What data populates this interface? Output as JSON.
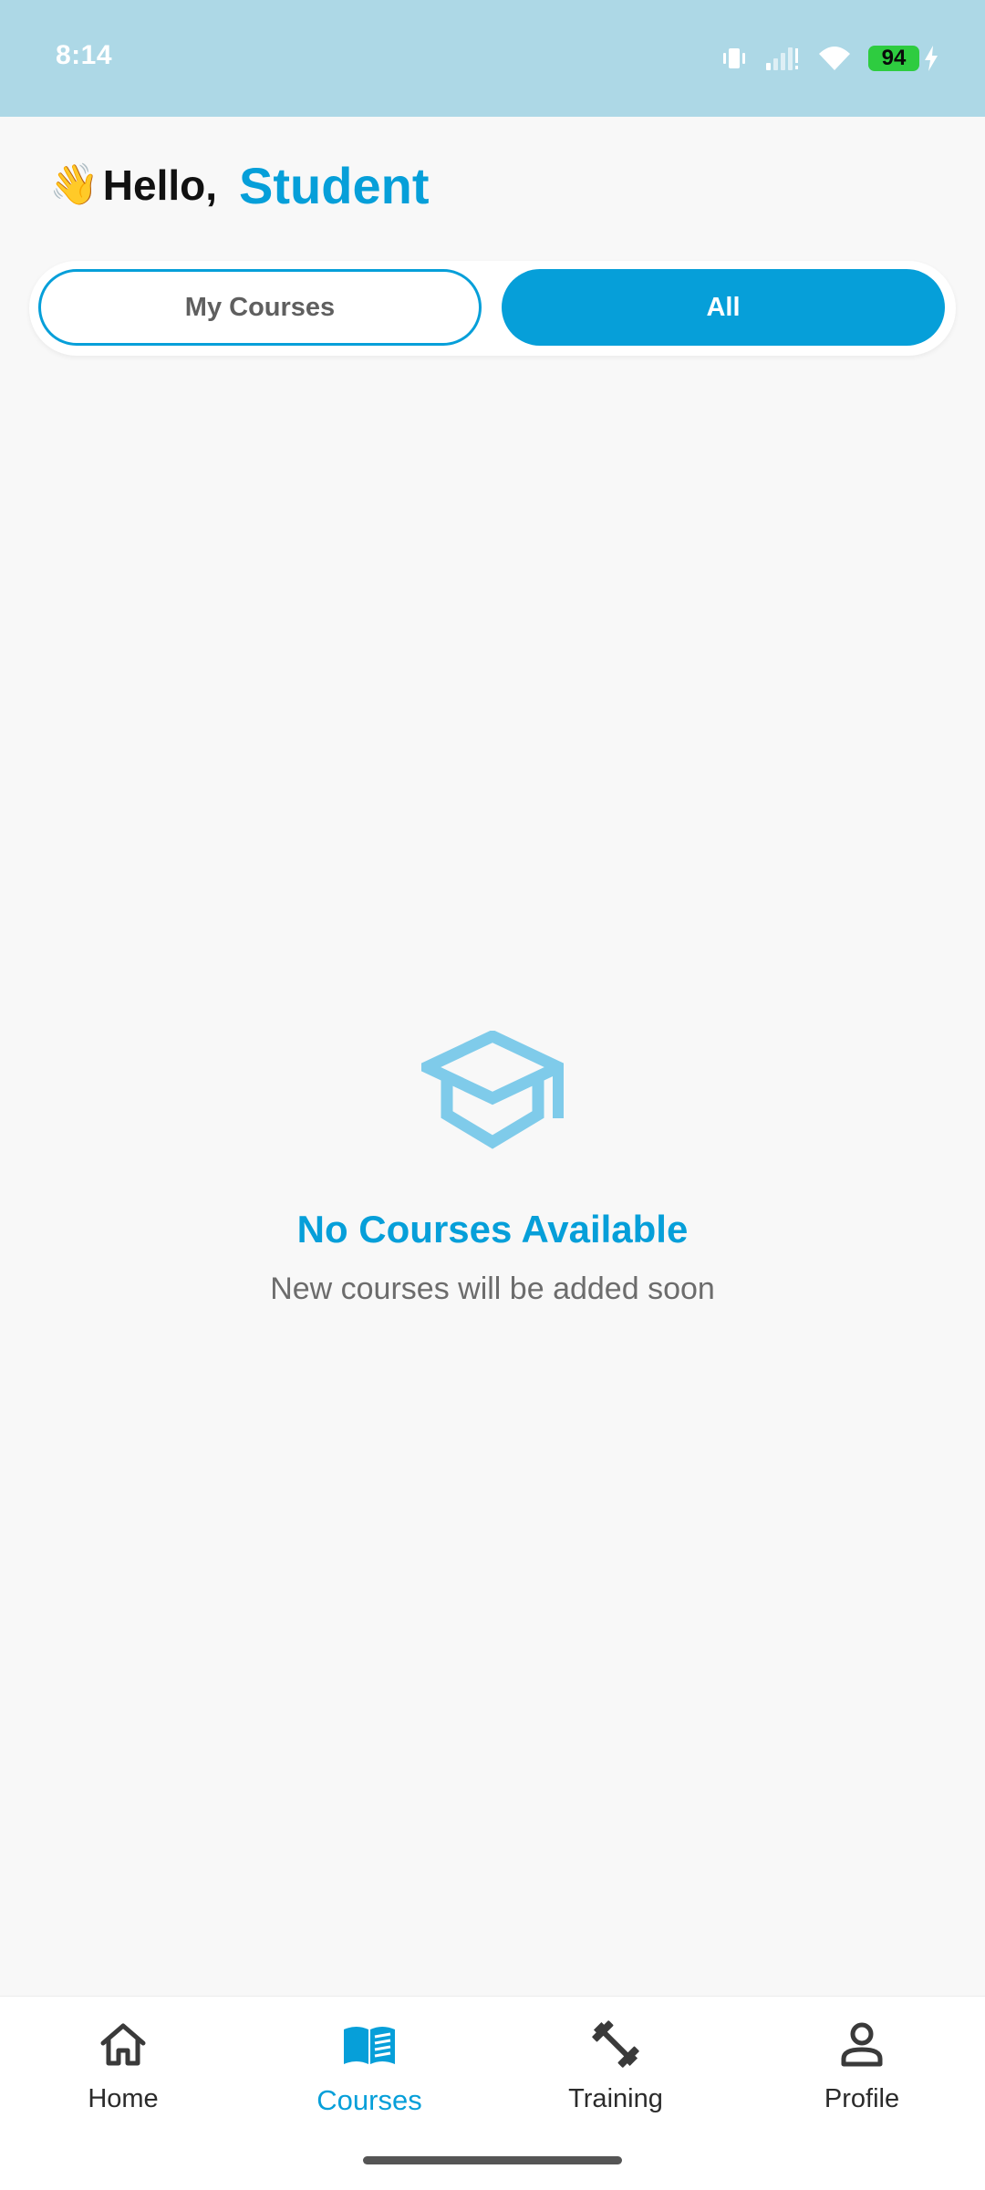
{
  "status_bar": {
    "time": "8:14",
    "battery": "94",
    "icons": [
      "vibrate-icon",
      "signal-icon",
      "wifi-icon",
      "battery-icon",
      "charging-icon"
    ]
  },
  "greeting": {
    "emoji": "👋",
    "hello": "Hello,",
    "name": "Student"
  },
  "tabs": [
    {
      "label": "My Courses",
      "selected": false
    },
    {
      "label": "All",
      "selected": true
    }
  ],
  "empty_state": {
    "icon": "graduation-cap-icon",
    "title": "No Courses Available",
    "subtitle": "New courses will be added soon"
  },
  "bottom_nav": {
    "items": [
      {
        "label": "Home",
        "icon": "home-icon",
        "active": false
      },
      {
        "label": "Courses",
        "icon": "book-icon",
        "active": true
      },
      {
        "label": "Training",
        "icon": "dumbbell-icon",
        "active": false
      },
      {
        "label": "Profile",
        "icon": "person-icon",
        "active": false
      }
    ]
  },
  "colors": {
    "accent": "#069fd9",
    "status_bar": "#add8e6",
    "icon_light": "#7fcbea",
    "background": "#f8f8f8"
  }
}
